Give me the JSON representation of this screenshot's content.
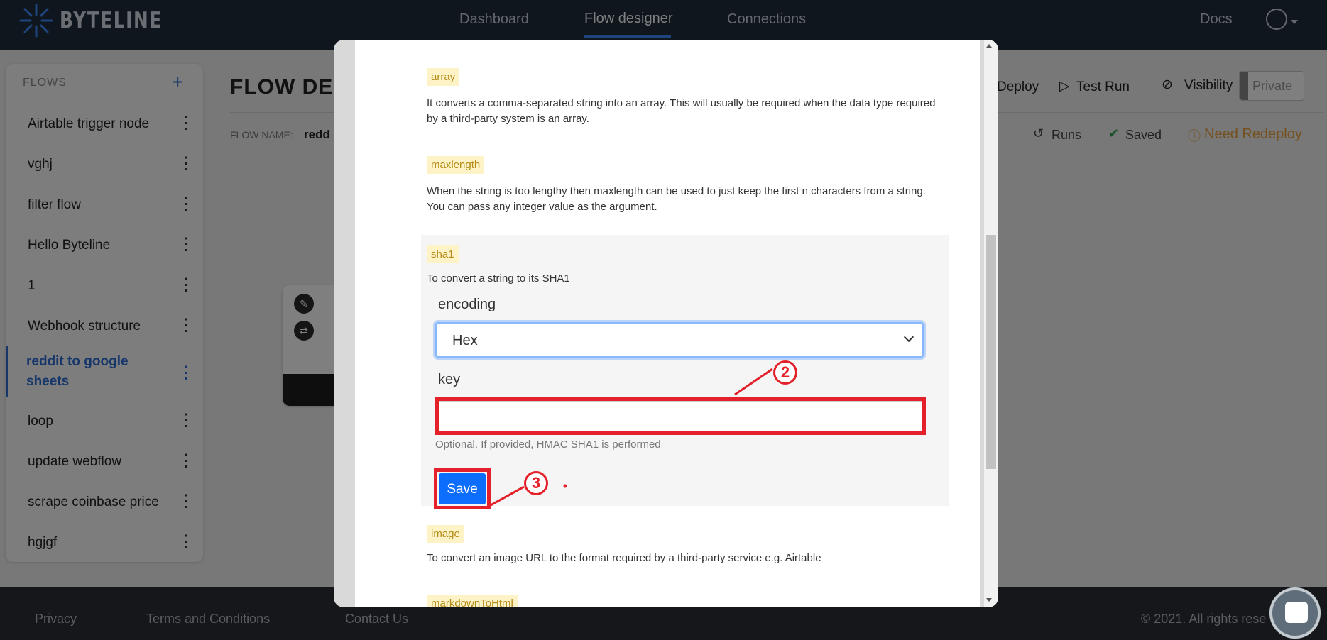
{
  "app": {
    "logo_text": "BYTELINE"
  },
  "nav": {
    "items": [
      "Dashboard",
      "Flow designer",
      "Connections"
    ],
    "docs": "Docs"
  },
  "sidebar": {
    "title": "FLOWS",
    "items": [
      {
        "label": "Airtable trigger node"
      },
      {
        "label": "vghj"
      },
      {
        "label": "filter flow"
      },
      {
        "label": "Hello Byteline"
      },
      {
        "label": "1"
      },
      {
        "label": "Webhook structure"
      },
      {
        "label": "reddit to google sheets"
      },
      {
        "label": "loop"
      },
      {
        "label": "update webflow"
      },
      {
        "label": "scrape coinbase price"
      },
      {
        "label": "hgjgf"
      }
    ]
  },
  "main": {
    "title": "FLOW DES",
    "flow_name_label": "FLOW NAME:",
    "flow_name_value": "redd",
    "toolbar": {
      "deploy": "Deploy",
      "test_run": "Test Run",
      "visibility": "Visibility",
      "private": "Private"
    },
    "status": {
      "runs": "Runs",
      "saved": "Saved",
      "need_redeploy": "Need Redeploy"
    }
  },
  "modal": {
    "functions": [
      {
        "tag": "array",
        "description": "It converts a comma-separated string into an array. This will usually be required when the data type required by a third-party system is an array."
      },
      {
        "tag": "maxlength",
        "description": "When the string is too lengthy then maxlength can be used to just keep the first n characters from a string. You can pass any integer value as the argument."
      },
      {
        "tag": "sha1",
        "description": "To convert a string to its SHA1"
      },
      {
        "tag": "image",
        "description": "To convert an image URL to the format required by a third-party service e.g. Airtable"
      },
      {
        "tag": "markdownToHtml",
        "description": ""
      }
    ],
    "sha1_form": {
      "encoding_label": "encoding",
      "encoding_value": "Hex",
      "key_label": "key",
      "key_value": "",
      "key_help": "Optional. If provided, HMAC SHA1 is performed",
      "save_label": "Save"
    },
    "annotations": [
      "2",
      "3"
    ]
  },
  "footer": {
    "links": [
      "Privacy",
      "Terms and Conditions",
      "Contact Us"
    ],
    "copyright": "© 2021. All rights rese"
  },
  "colors": {
    "accent": "#0d6efd",
    "highlight": "#e4202a",
    "topbar": "#1f2d3d",
    "warning": "#e8a33d"
  }
}
